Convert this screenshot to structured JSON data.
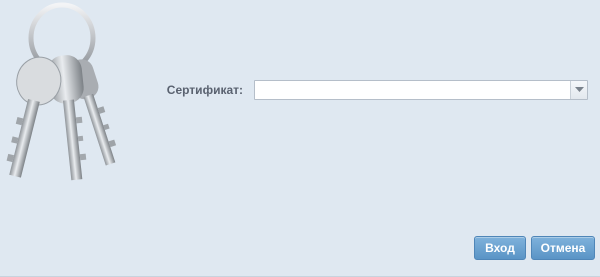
{
  "form": {
    "certificate_label": "Сертификат:",
    "certificate_value": ""
  },
  "buttons": {
    "login_label": "Вход",
    "cancel_label": "Отмена"
  },
  "icons": {
    "keys": "keys-image",
    "dropdown": "chevron-down-icon"
  },
  "colors": {
    "background": "#dfe8f1",
    "button": "#6aa3d4",
    "label": "#5a6270"
  }
}
